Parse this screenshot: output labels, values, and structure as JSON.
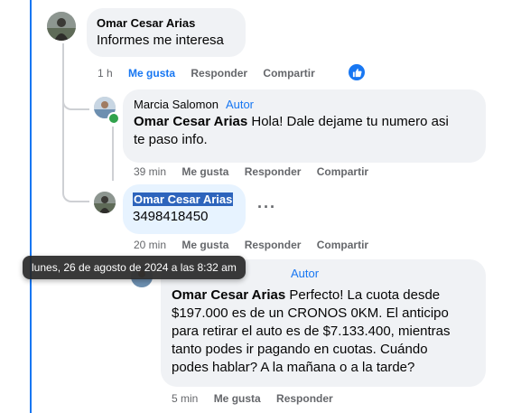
{
  "comments": [
    {
      "author": "Omar Cesar Arias",
      "text": "Informes me interesa",
      "time": "1 h",
      "like": "Me gusta",
      "reply": "Responder",
      "share": "Compartir"
    },
    {
      "author": "Marcia Salomon",
      "tag": "Autor",
      "mention": "Omar Cesar Arias",
      "text_line1": " Hola! Dale dejame tu numero asi",
      "text_line2": "te paso info.",
      "time": "39 min",
      "like": "Me gusta",
      "reply": "Responder",
      "share": "Compartir"
    },
    {
      "author": "Omar Cesar Arias",
      "text": "3498418450",
      "more": "···",
      "time": "20 min",
      "like": "Me gusta",
      "reply": "Responder",
      "share": "Compartir"
    },
    {
      "tag": "Autor",
      "mention": "Omar Cesar Arias",
      "text_l1": " Perfecto! La cuota desde",
      "text_l2": "$197.000 es de un CRONOS 0KM. El anticipo",
      "text_l3": "para retirar el auto es de $7.133.400, mientras",
      "text_l4": "tanto podes ir pagando en cuotas. Cuándo",
      "text_l5": "podes hablar? A la mañana o a la tarde?",
      "time": "5 min",
      "like": "Me gusta",
      "reply": "Responder"
    }
  ],
  "tooltip": "lunes, 26 de agosto de 2024 a las 8:32 am",
  "colors": {
    "accent": "#1877f2",
    "bubble": "#f0f2f5",
    "highlight_bubble": "#e7f3ff",
    "muted": "#65676b",
    "online": "#31a24c"
  }
}
